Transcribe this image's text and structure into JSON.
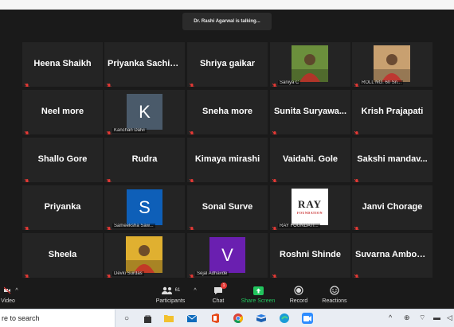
{
  "speaker_banner": "Dr. Rashi Agarwal is talking...",
  "participants": [
    {
      "name": "Heena Shaikh",
      "type": "name"
    },
    {
      "name": "Priyanka  Sachin...",
      "type": "name"
    },
    {
      "name": "Shriya gaikar",
      "type": "name"
    },
    {
      "name": "",
      "type": "photo",
      "label": "Saniya C",
      "photo_color": "#6b8f3c"
    },
    {
      "name": "",
      "type": "photo",
      "label": "ROLL NO. 60 Sn...",
      "photo_color": "#c8a070"
    },
    {
      "name": "Neel more",
      "type": "name"
    },
    {
      "name": "",
      "type": "avatar",
      "letter": "K",
      "avatar_color": "#4a5a6a",
      "label": "Kanchan Dalvi"
    },
    {
      "name": "Sneha more",
      "type": "name"
    },
    {
      "name": "Sunita  Suryawa...",
      "type": "name"
    },
    {
      "name": "Krish Prajapati",
      "type": "name"
    },
    {
      "name": "Shallo Gore",
      "type": "name"
    },
    {
      "name": "Rudra",
      "type": "name"
    },
    {
      "name": "Kimaya mirashi",
      "type": "name"
    },
    {
      "name": "Vaidahi. Gole",
      "type": "name"
    },
    {
      "name": "Sakshi  mandav...",
      "type": "name"
    },
    {
      "name": "Priyanka",
      "type": "name"
    },
    {
      "name": "",
      "type": "avatar",
      "letter": "S",
      "avatar_color": "#0e5fb8",
      "label": "Sameeksha Saw..."
    },
    {
      "name": "Sonal Surve",
      "type": "name"
    },
    {
      "name": "",
      "type": "logo",
      "logo_text": "RAY",
      "logo_sub": "FOUNDATION",
      "label": "RAY FOUNDATI..."
    },
    {
      "name": "Janvi Chorage",
      "type": "name"
    },
    {
      "name": "Sheela",
      "type": "name"
    },
    {
      "name": "",
      "type": "photo",
      "label": "Devki Surdas",
      "photo_color": "#e0b030"
    },
    {
      "name": "",
      "type": "avatar",
      "letter": "V",
      "avatar_color": "#6a1fb0",
      "label": "Sejal Adhavde"
    },
    {
      "name": "Roshni Shinde",
      "type": "name"
    },
    {
      "name": "Suvarna Ambokar",
      "type": "name"
    }
  ],
  "toolbar": {
    "video_label": "Video",
    "participants_label": "Participants",
    "participants_count": "61",
    "chat_label": "Chat",
    "chat_badge": "1",
    "share_label": "Share Screen",
    "record_label": "Record",
    "reactions_label": "Reactions"
  },
  "taskbar": {
    "search_placeholder": "re to search"
  },
  "colors": {
    "tile_bg": "#242424",
    "mute_red": "#e53935",
    "share_green": "#22c55e"
  }
}
